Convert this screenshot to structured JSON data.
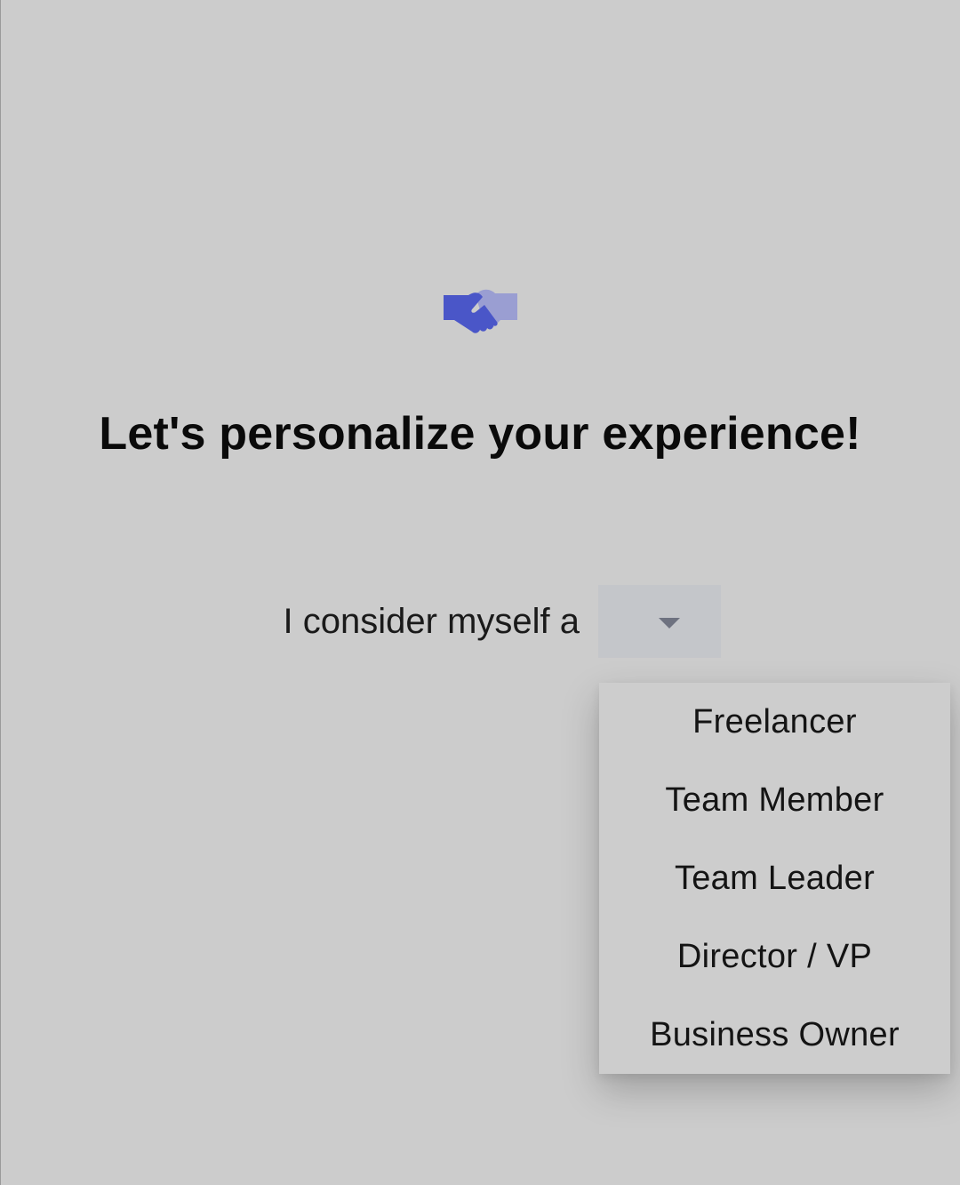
{
  "header": {
    "icon": "handshake-icon",
    "title": "Let's personalize your experience!"
  },
  "prompt": {
    "label": "I consider myself a",
    "selected_value": ""
  },
  "dropdown": {
    "options": [
      "Freelancer",
      "Team Member",
      "Team Leader",
      "Director / VP",
      "Business Owner"
    ]
  },
  "colors": {
    "background": "#cccccc",
    "accent_dark": "#4a56c8",
    "accent_light": "#9a9ed2",
    "select_bg": "#c4c6ca"
  }
}
